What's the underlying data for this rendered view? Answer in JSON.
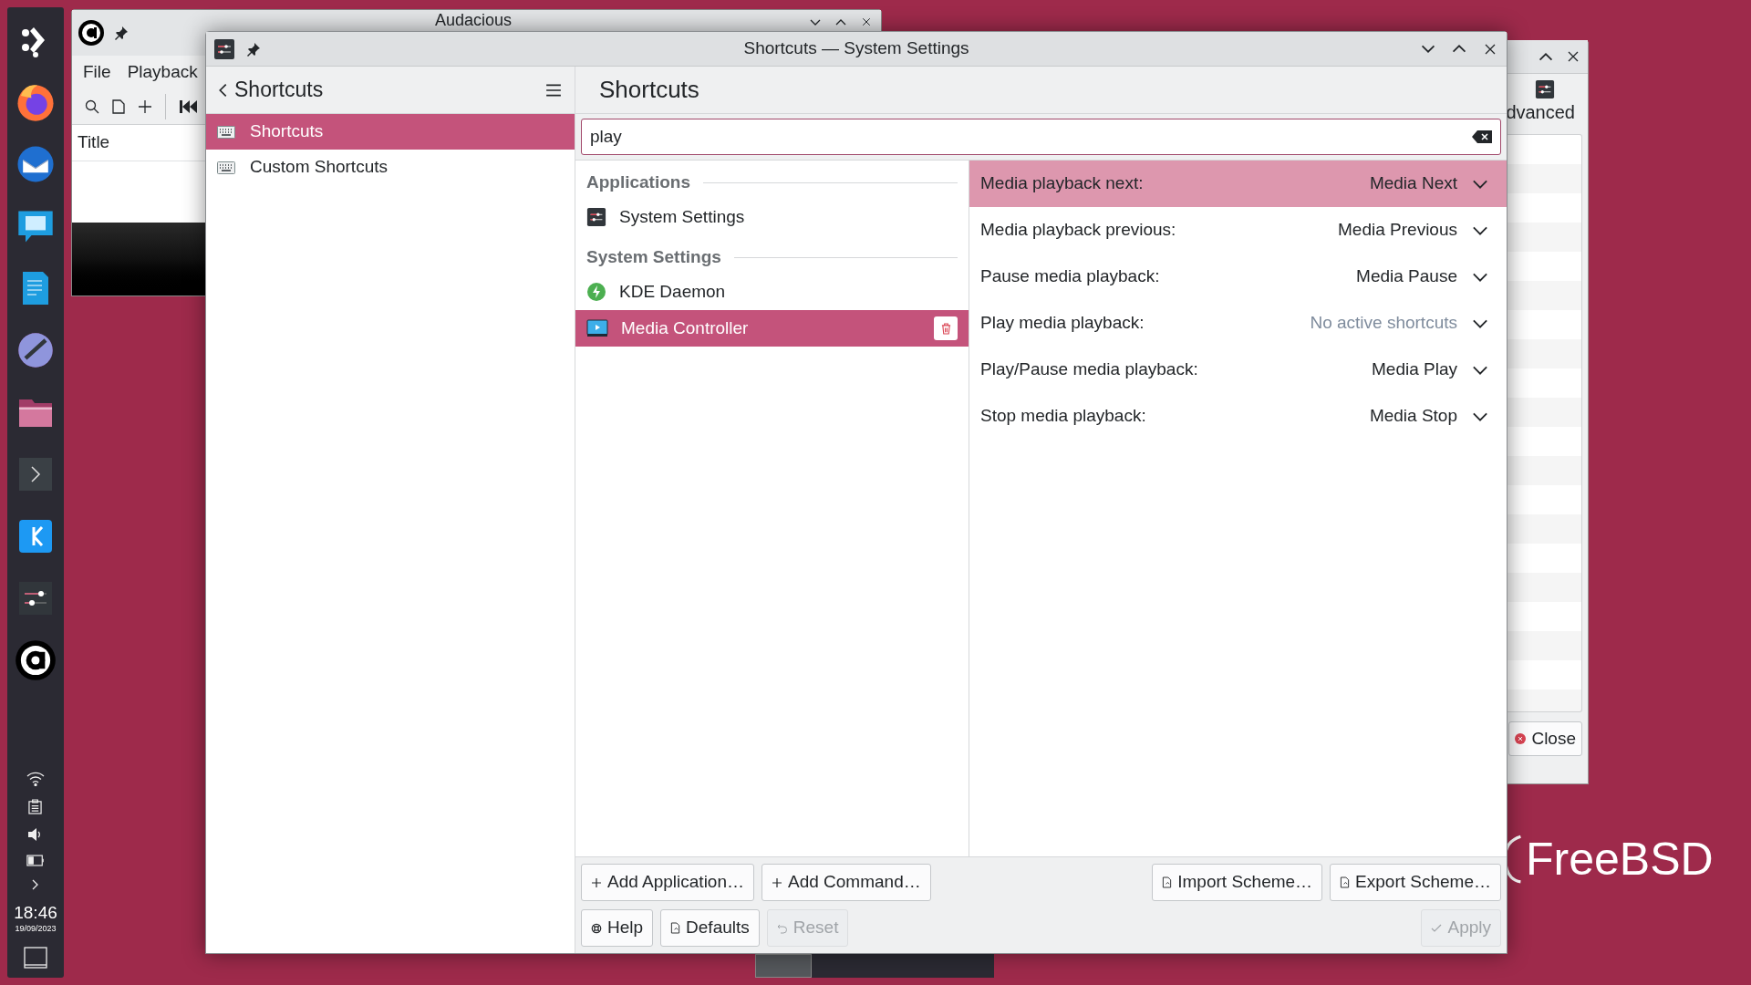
{
  "taskbar": {
    "clock": "18:46",
    "date": "19/09/2023"
  },
  "audacious": {
    "title": "Audacious",
    "menu": [
      "File",
      "Playback"
    ],
    "column": "Title"
  },
  "back_window": {
    "tab_label": "dvanced",
    "close_button": "Close"
  },
  "wallpaper_logo": "FreeBSD",
  "settings": {
    "title": "Shortcuts — System Settings",
    "sidebar": {
      "header": "Shortcuts",
      "items": [
        {
          "label": "Shortcuts",
          "selected": true
        },
        {
          "label": "Custom Shortcuts",
          "selected": false
        }
      ]
    },
    "page_title": "Shortcuts",
    "search": {
      "value": "play"
    },
    "groups": [
      {
        "heading": "Applications",
        "items": [
          {
            "label": "System Settings",
            "kind": "settings",
            "selected": false
          }
        ]
      },
      {
        "heading": "System Settings",
        "items": [
          {
            "label": "KDE Daemon",
            "kind": "daemon",
            "selected": false
          },
          {
            "label": "Media Controller",
            "kind": "media",
            "selected": true
          }
        ]
      }
    ],
    "shortcuts": [
      {
        "action": "Media playback next:",
        "shortcut": "Media Next",
        "assigned": true,
        "selected": true
      },
      {
        "action": "Media playback previous:",
        "shortcut": "Media Previous",
        "assigned": true,
        "selected": false
      },
      {
        "action": "Pause media playback:",
        "shortcut": "Media Pause",
        "assigned": true,
        "selected": false
      },
      {
        "action": "Play media playback:",
        "shortcut": "No active shortcuts",
        "assigned": false,
        "selected": false
      },
      {
        "action": "Play/Pause media playback:",
        "shortcut": "Media Play",
        "assigned": true,
        "selected": false
      },
      {
        "action": "Stop media playback:",
        "shortcut": "Media Stop",
        "assigned": true,
        "selected": false
      }
    ],
    "button_rows": [
      {
        "left": [
          {
            "label": "Add Application…",
            "kind": "add",
            "disabled": false
          },
          {
            "label": "Add Command…",
            "kind": "add",
            "disabled": false
          }
        ],
        "right": [
          {
            "label": "Import Scheme…",
            "kind": "import",
            "disabled": false
          },
          {
            "label": "Export Scheme…",
            "kind": "export",
            "disabled": false
          }
        ]
      },
      {
        "left": [
          {
            "label": "Help",
            "kind": "help",
            "disabled": false
          },
          {
            "label": "Defaults",
            "kind": "defaults",
            "disabled": false
          },
          {
            "label": "Reset",
            "kind": "reset",
            "disabled": true
          }
        ],
        "right": [
          {
            "label": "Apply",
            "kind": "apply",
            "disabled": true
          }
        ]
      }
    ]
  }
}
